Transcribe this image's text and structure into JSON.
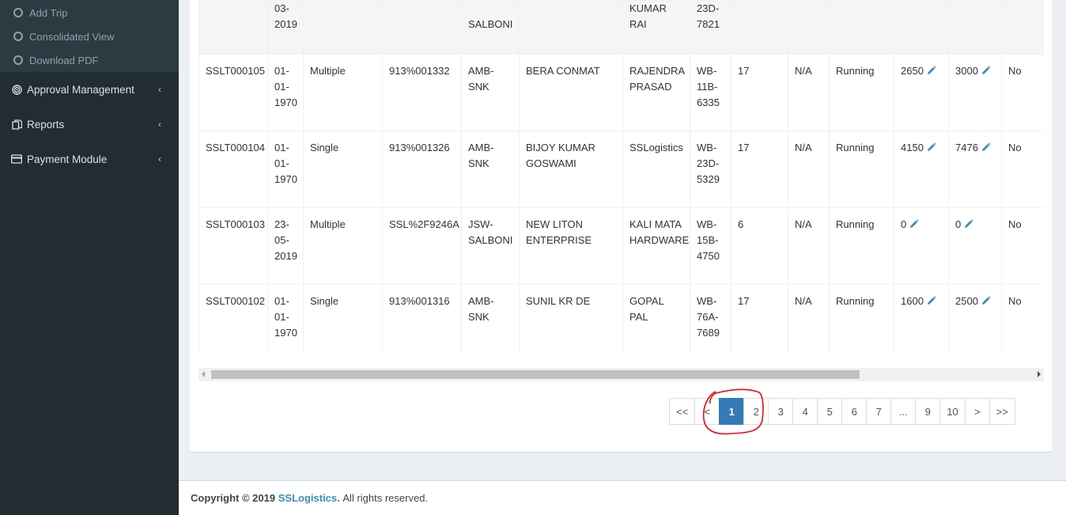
{
  "sidebar": {
    "sub_items": [
      {
        "label": "Add Trip"
      },
      {
        "label": "Consolidated View"
      },
      {
        "label": "Download PDF"
      }
    ],
    "menu_items": [
      {
        "label": "Approval Management",
        "icon": "target-icon"
      },
      {
        "label": "Reports",
        "icon": "copy-icon"
      },
      {
        "label": "Payment Module",
        "icon": "credit-card-icon"
      }
    ]
  },
  "table": {
    "partial_row": [
      "",
      "03-\n2019",
      "",
      "",
      "SALBONI",
      "",
      "KUMAR RAI",
      "23D-\n7821",
      "",
      "",
      "",
      "",
      "",
      ""
    ],
    "rows": [
      {
        "id": "SSLT000105",
        "date": "01-\n01-\n1970",
        "type": "Multiple",
        "ref": "913%001332",
        "route": "AMB-SNK",
        "party": "BERA CONMAT",
        "consignee": "RAJENDRA\nPRASAD",
        "vehicle": "WB-\n11B-\n6335",
        "qty": "17",
        "na": "N/A",
        "status": "Running",
        "amount1": "2650",
        "amount2": "3000",
        "flag": "No"
      },
      {
        "id": "SSLT000104",
        "date": "01-\n01-\n1970",
        "type": "Single",
        "ref": "913%001326",
        "route": "AMB-SNK",
        "party": "BIJOY KUMAR\nGOSWAMI",
        "consignee": "SSLogistics",
        "vehicle": "WB-\n23D-\n5329",
        "qty": "17",
        "na": "N/A",
        "status": "Running",
        "amount1": "4150",
        "amount2": "7476",
        "flag": "No"
      },
      {
        "id": "SSLT000103",
        "date": "23-\n05-\n2019",
        "type": "Multiple",
        "ref": "SSL%2F9246A",
        "route": "JSW-\nSALBONI",
        "party": "NEW LITON\nENTERPRISE",
        "consignee": "KALI MATA\nHARDWARE",
        "vehicle": "WB-\n15B-\n4750",
        "qty": "6",
        "na": "N/A",
        "status": "Running",
        "amount1": "0",
        "amount2": "0",
        "flag": "No"
      },
      {
        "id": "SSLT000102",
        "date": "01-\n01-\n1970",
        "type": "Single",
        "ref": "913%001316",
        "route": "AMB-SNK",
        "party": "SUNIL KR DE",
        "consignee": "GOPAL PAL",
        "vehicle": "WB-\n76A-\n7689",
        "qty": "17",
        "na": "N/A",
        "status": "Running",
        "amount1": "1600",
        "amount2": "2500",
        "flag": "No"
      }
    ]
  },
  "pagination": {
    "items": [
      "<<",
      "<",
      "1",
      "2",
      "3",
      "4",
      "5",
      "6",
      "7",
      "...",
      "9",
      "10",
      ">",
      ">>"
    ],
    "active": "1"
  },
  "footer": {
    "prefix": "Copyright © 2019",
    "brand": "SSLogistics.",
    "suffix": "All rights reserved."
  },
  "colors": {
    "sidebar_bg": "#222d32",
    "active_page": "#337ab7",
    "link": "#3c8dbc",
    "pencil": "#3c8dbc",
    "annotation": "#e0101a"
  }
}
